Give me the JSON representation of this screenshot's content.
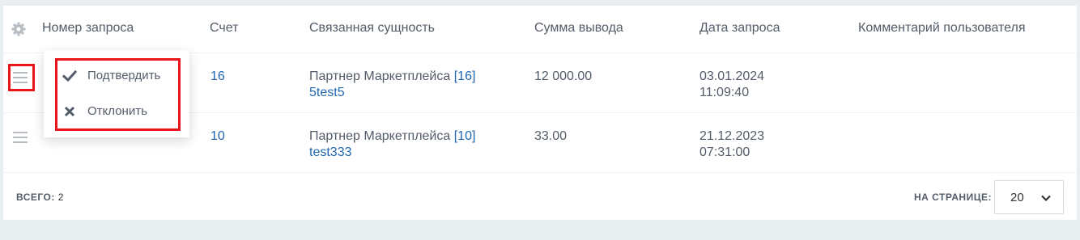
{
  "table": {
    "columns": [
      "Номер запроса",
      "Счет",
      "Связанная сущность",
      "Сумма вывода",
      "Дата запроса",
      "Комментарий пользователя"
    ],
    "rows": [
      {
        "account": "16",
        "entity_name": "Партнер Маркетплейса",
        "entity_id": "[16]",
        "entity_sub": "5test5",
        "amount": "12 000.00",
        "date": "03.01.2024",
        "time": "11:09:40",
        "comment": ""
      },
      {
        "account": "10",
        "entity_name": "Партнер Маркетплейса",
        "entity_id": "[10]",
        "entity_sub": "test333",
        "amount": "33.00",
        "date": "21.12.2023",
        "time": "07:31:00",
        "comment": ""
      }
    ]
  },
  "context_menu": {
    "confirm_label": "Подтвердить",
    "reject_label": "Отклонить"
  },
  "footer": {
    "total_label": "ВСЕГО:",
    "total_value": "2",
    "per_page_label": "НА СТРАНИЦЕ:",
    "per_page_value": "20"
  },
  "colors": {
    "link": "#2067b0",
    "highlight": "#e8161b",
    "text": "#535c69"
  },
  "icons": [
    "gear-icon",
    "menu-burger-icon",
    "checkmark-icon",
    "cross-icon",
    "chevron-down-icon"
  ]
}
